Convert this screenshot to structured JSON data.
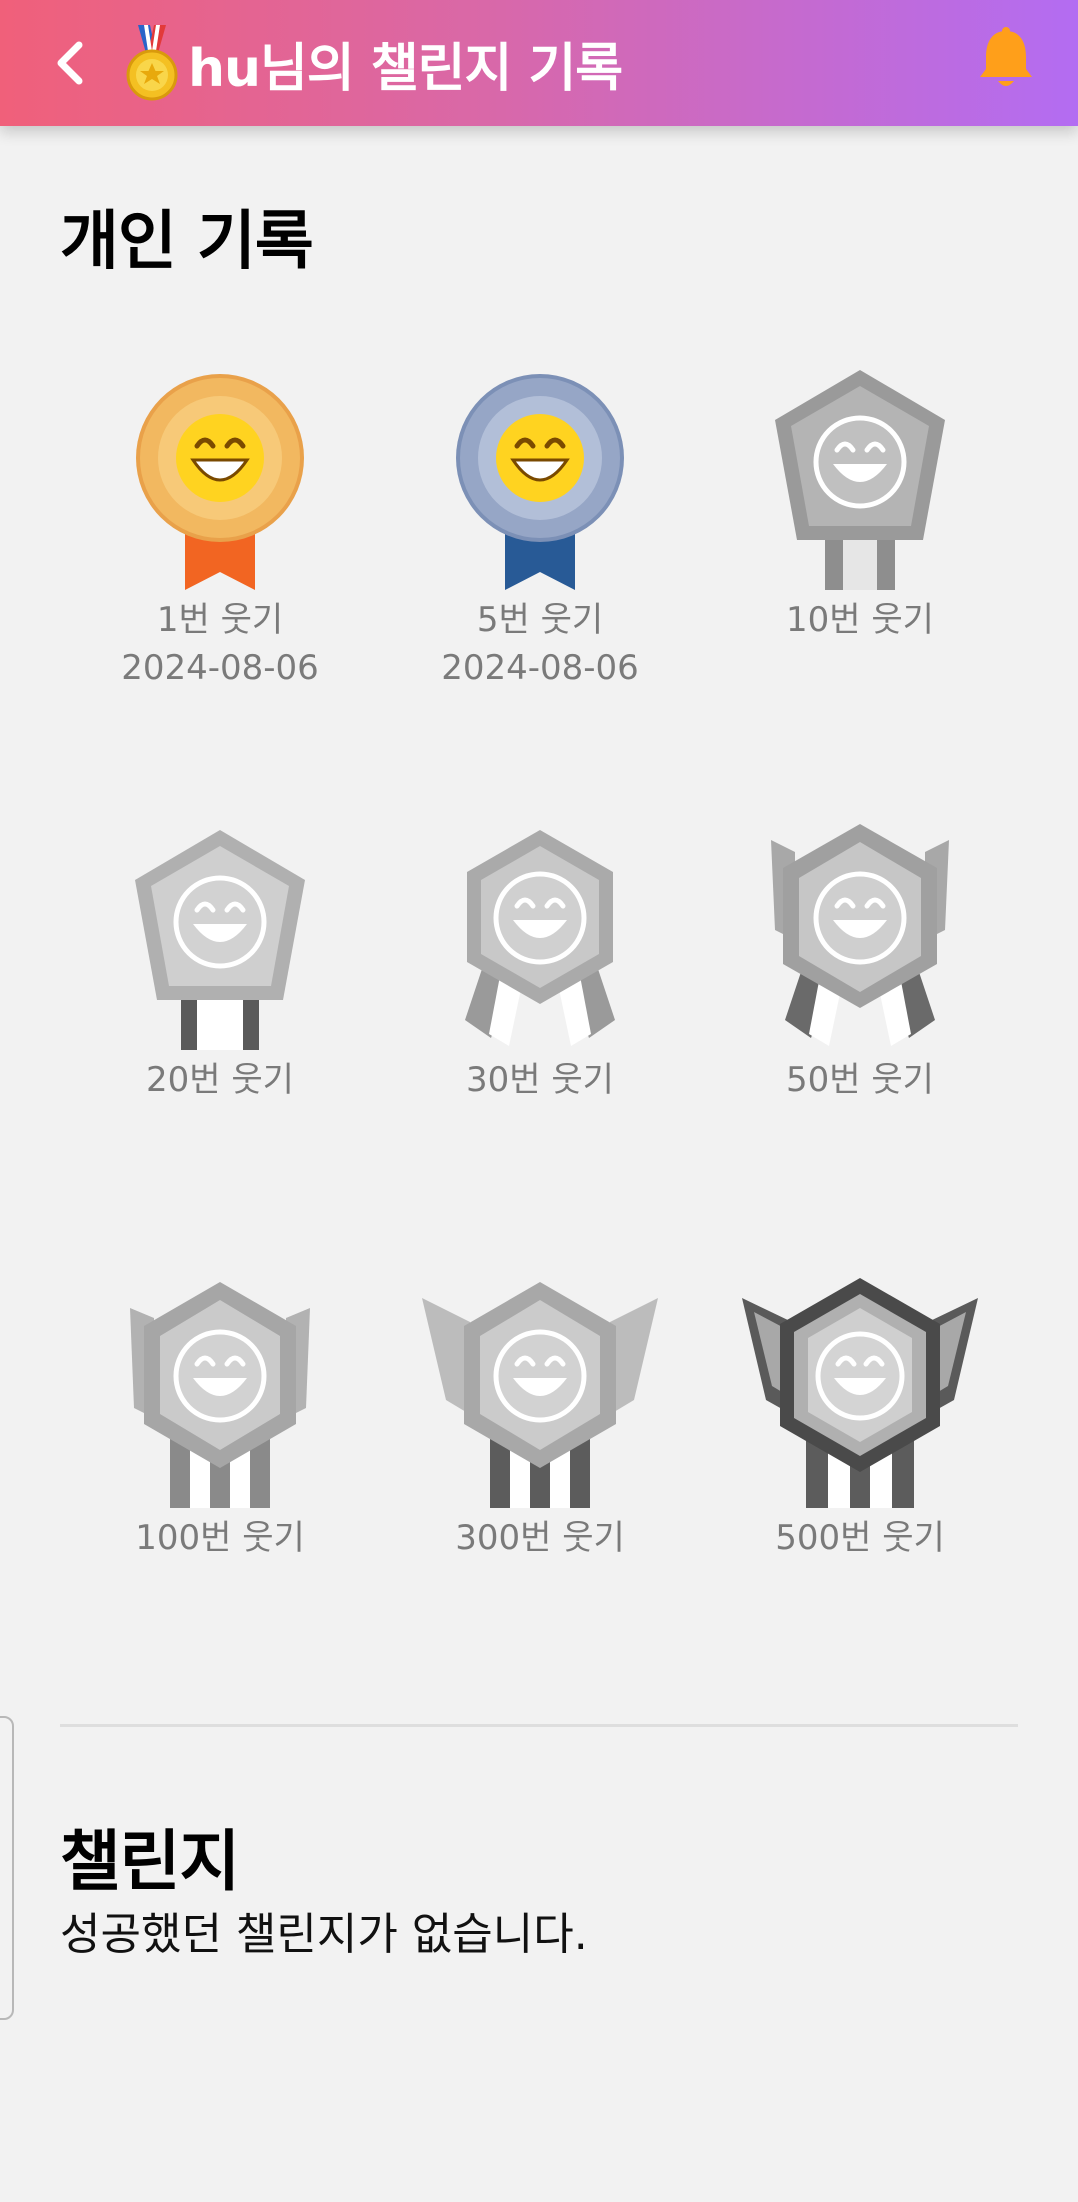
{
  "header": {
    "title": "hu님의 챌린지 기록",
    "back_icon": "chevron-left-icon",
    "medal_icon": "medal-icon",
    "bell_icon": "bell-icon",
    "colors": {
      "gradient_start": "#f0607a",
      "gradient_end": "#b36cf2",
      "bell": "#ff9f1a"
    }
  },
  "personal": {
    "title": "개인 기록",
    "badges": [
      {
        "label": "1번 웃기",
        "date": "2024-08-06",
        "earned": true,
        "tier": "bronze"
      },
      {
        "label": "5번 웃기",
        "date": "2024-08-06",
        "earned": true,
        "tier": "silver-blue"
      },
      {
        "label": "10번 웃기",
        "date": "",
        "earned": false,
        "tier": "pentagon"
      },
      {
        "label": "20번 웃기",
        "date": "",
        "earned": false,
        "tier": "pentagon-ribbon"
      },
      {
        "label": "30번 웃기",
        "date": "",
        "earned": false,
        "tier": "hexagon"
      },
      {
        "label": "50번 웃기",
        "date": "",
        "earned": false,
        "tier": "hexagon-crest"
      },
      {
        "label": "100번 웃기",
        "date": "",
        "earned": false,
        "tier": "hexagon-ribbon"
      },
      {
        "label": "300번 웃기",
        "date": "",
        "earned": false,
        "tier": "hexagon-wings"
      },
      {
        "label": "500번 웃기",
        "date": "",
        "earned": false,
        "tier": "hexagon-wings-dark"
      }
    ]
  },
  "challenge": {
    "title": "챌린지",
    "empty_message": "성공했던 챌린지가 없습니다."
  }
}
